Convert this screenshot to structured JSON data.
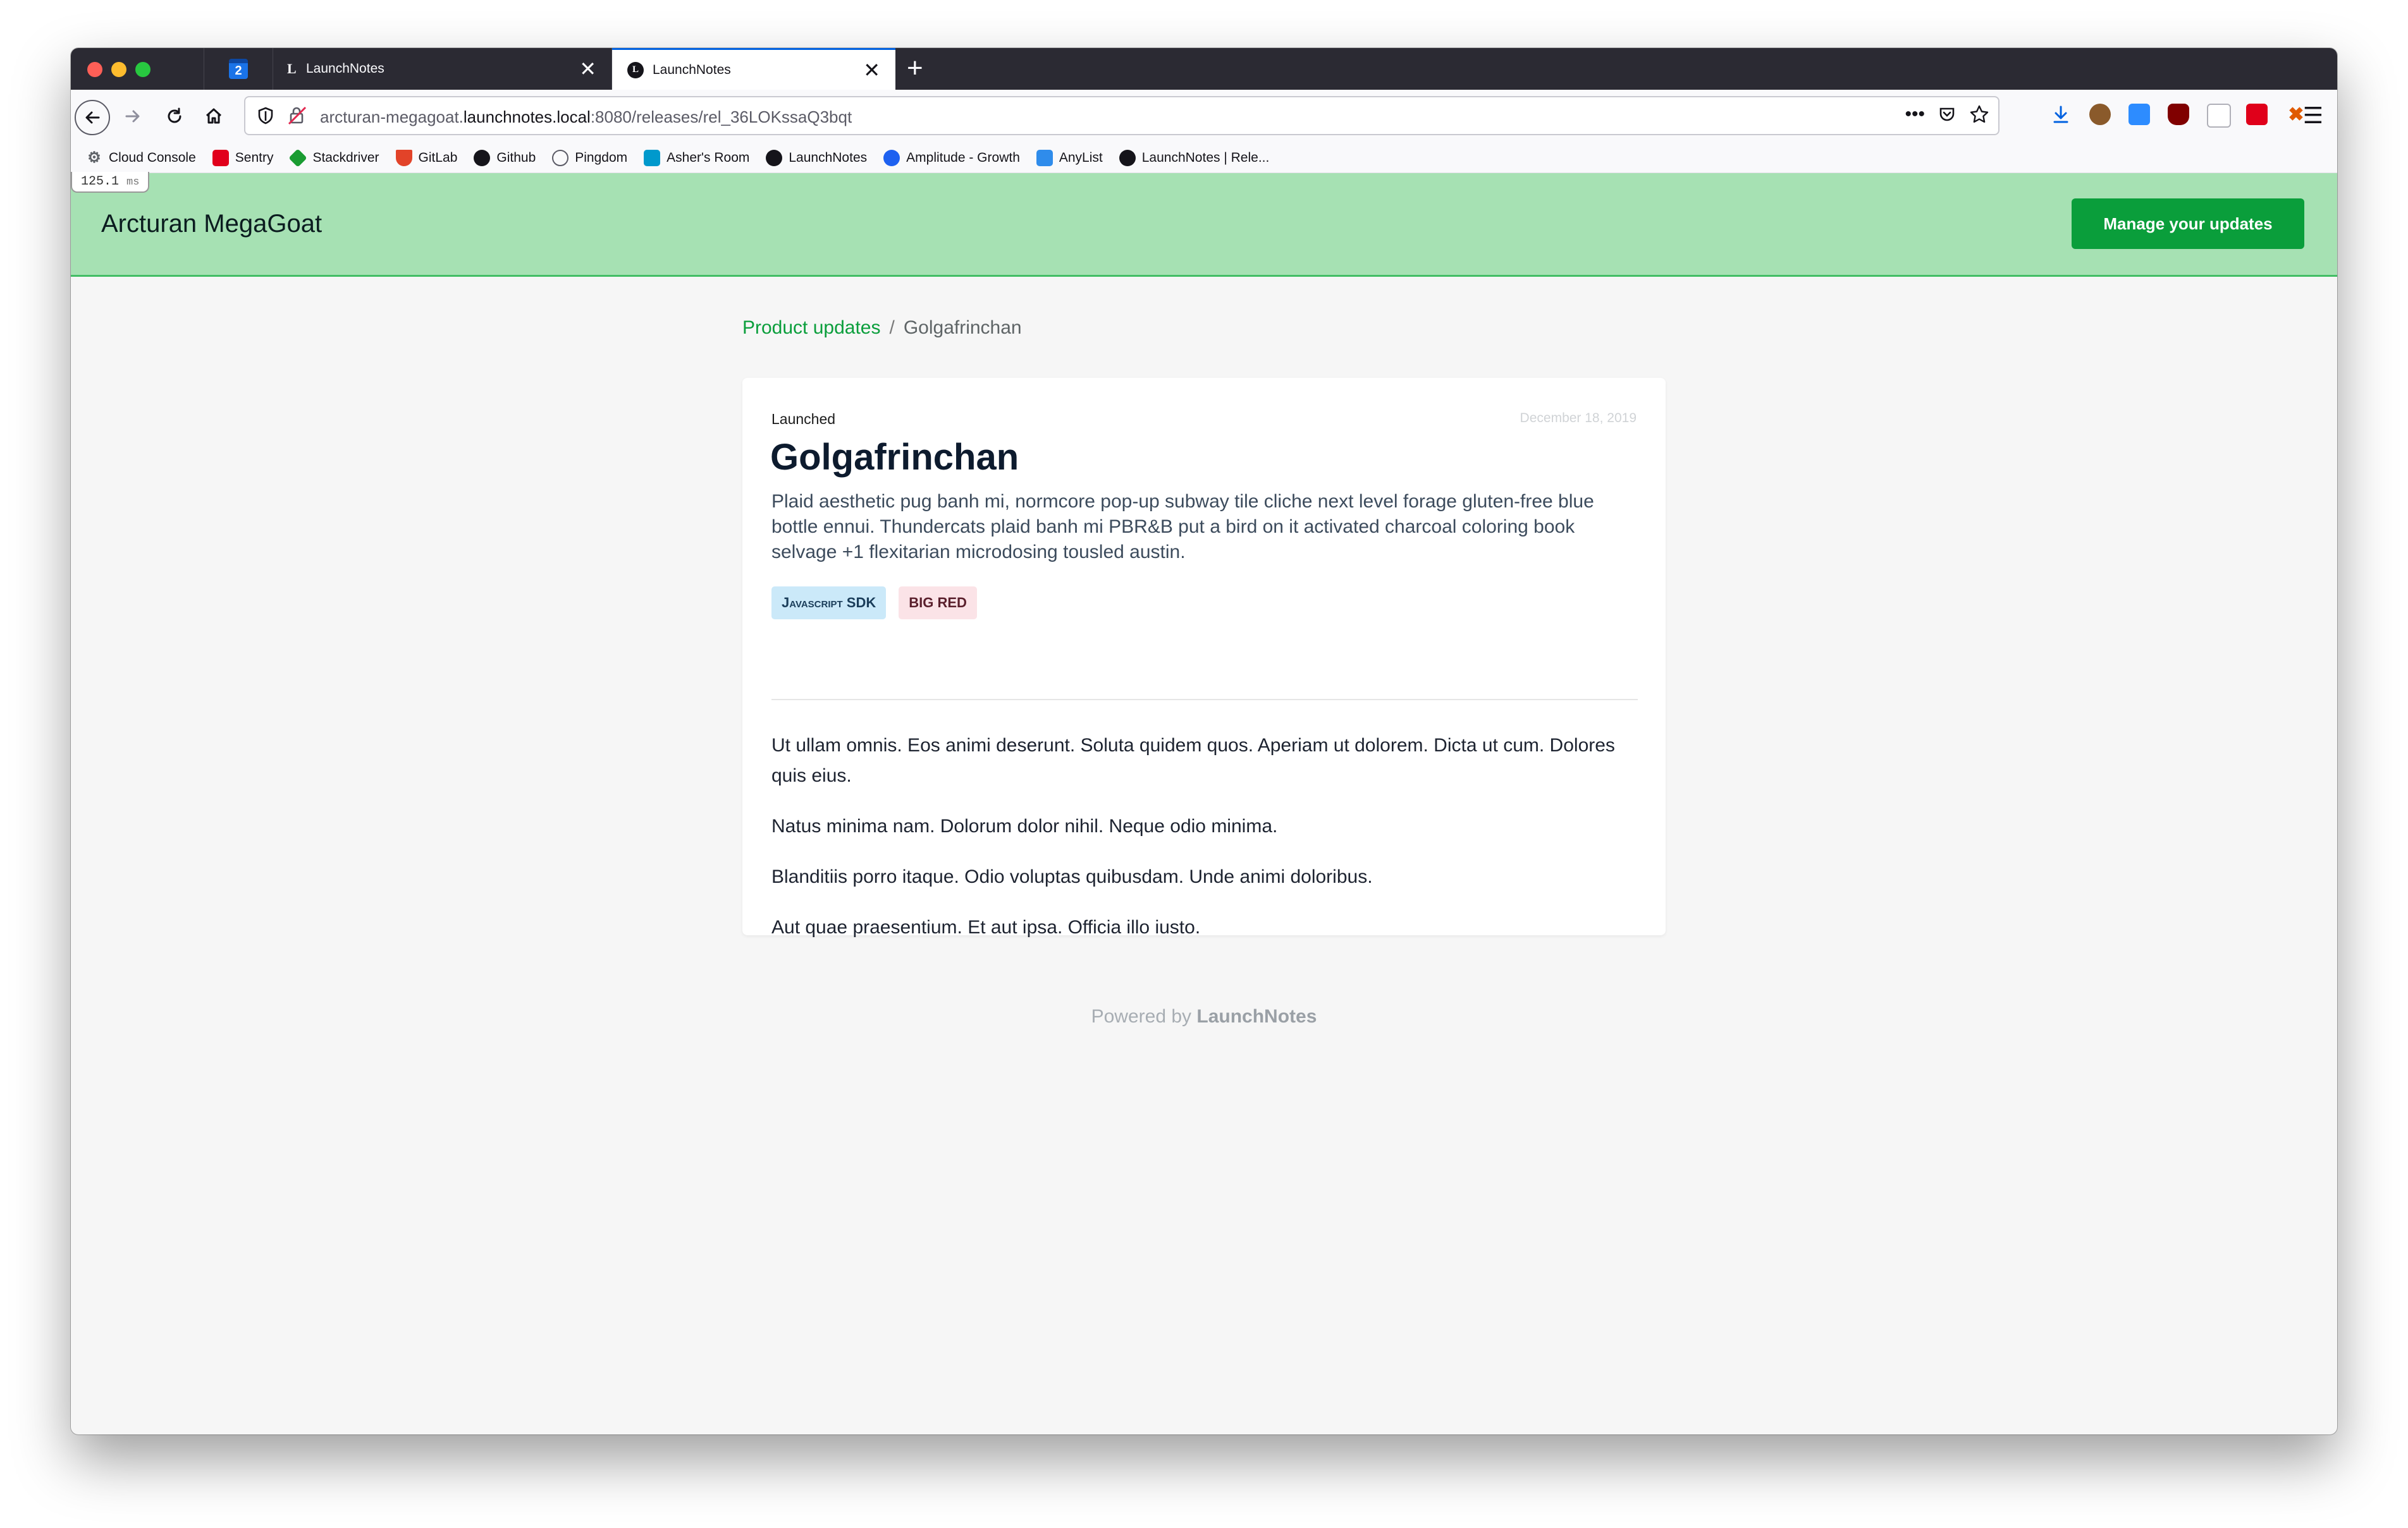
{
  "browser": {
    "tabs": [
      {
        "label": "LaunchNotes",
        "favicon": "L"
      },
      {
        "label": "LaunchNotes",
        "favicon": "L"
      }
    ],
    "pinned_tab_icon": "calendar-icon",
    "pinned_tab_text": "2",
    "new_tab": "+",
    "close_glyph": "✕",
    "url": {
      "prefix": "arcturan-megagoat.",
      "host": "launchnotes.local",
      "path": ":8080/releases/rel_36LOKssaQ3bqt"
    },
    "bookmarks": [
      {
        "label": "Cloud Console",
        "icon": "gear-icon",
        "color": "#5f6368"
      },
      {
        "label": "Sentry",
        "icon": "sentry-icon",
        "color": "#e1001b"
      },
      {
        "label": "Stackdriver",
        "icon": "stackdriver-icon",
        "color": "#1a9c32"
      },
      {
        "label": "GitLab",
        "icon": "gitlab-icon",
        "color": "#e24329"
      },
      {
        "label": "Github",
        "icon": "github-icon",
        "color": "#15141a"
      },
      {
        "label": "Pingdom",
        "icon": "globe-icon",
        "color": "#5b5b66"
      },
      {
        "label": "Asher's Room",
        "icon": "door-icon",
        "color": "#0099cc"
      },
      {
        "label": "LaunchNotes",
        "icon": "launchnotes-icon",
        "color": "#15141a"
      },
      {
        "label": "Amplitude - Growth",
        "icon": "amplitude-icon",
        "color": "#1e61f0"
      },
      {
        "label": "AnyList",
        "icon": "list-icon",
        "color": "#2f8ceb"
      },
      {
        "label": "LaunchNotes | Rele...",
        "icon": "launchnotes-icon",
        "color": "#15141a"
      }
    ]
  },
  "timing": {
    "value": "125.1",
    "unit": "ms"
  },
  "header": {
    "site_title": "Arcturan MegaGoat",
    "manage_button": "Manage your updates",
    "background": "#a6e1b3",
    "accent": "#0a9e3b"
  },
  "breadcrumb": {
    "parent": "Product updates",
    "separator": "/",
    "current": "Golgafrinchan"
  },
  "release": {
    "status": "Launched",
    "date": "December 18, 2019",
    "title": "Golgafrinchan",
    "summary": "Plaid aesthetic pug banh mi, normcore pop-up subway tile cliche next level forage gluten-free blue bottle ennui. Thundercats plaid banh mi PBR&B put a bird on it activated charcoal coloring book selvage +1 flexitarian microdosing tousled austin.",
    "tags": [
      {
        "label": "Javascript SDK",
        "color": "#cbe9f9"
      },
      {
        "label": "BIG RED",
        "color": "#fbe3e7"
      }
    ],
    "paragraphs": [
      "Ut ullam omnis. Eos animi deserunt. Soluta quidem quos. Aperiam ut dolorem. Dicta ut cum. Dolores quis eius.",
      "Natus minima nam. Dolorum dolor nihil. Neque odio minima.",
      "Blanditiis porro itaque. Odio voluptas quibusdam. Unde animi doloribus.",
      "Aut quae praesentium. Et aut ipsa. Officia illo iusto."
    ]
  },
  "footer": {
    "prefix": "Powered by",
    "brand": "LaunchNotes"
  }
}
